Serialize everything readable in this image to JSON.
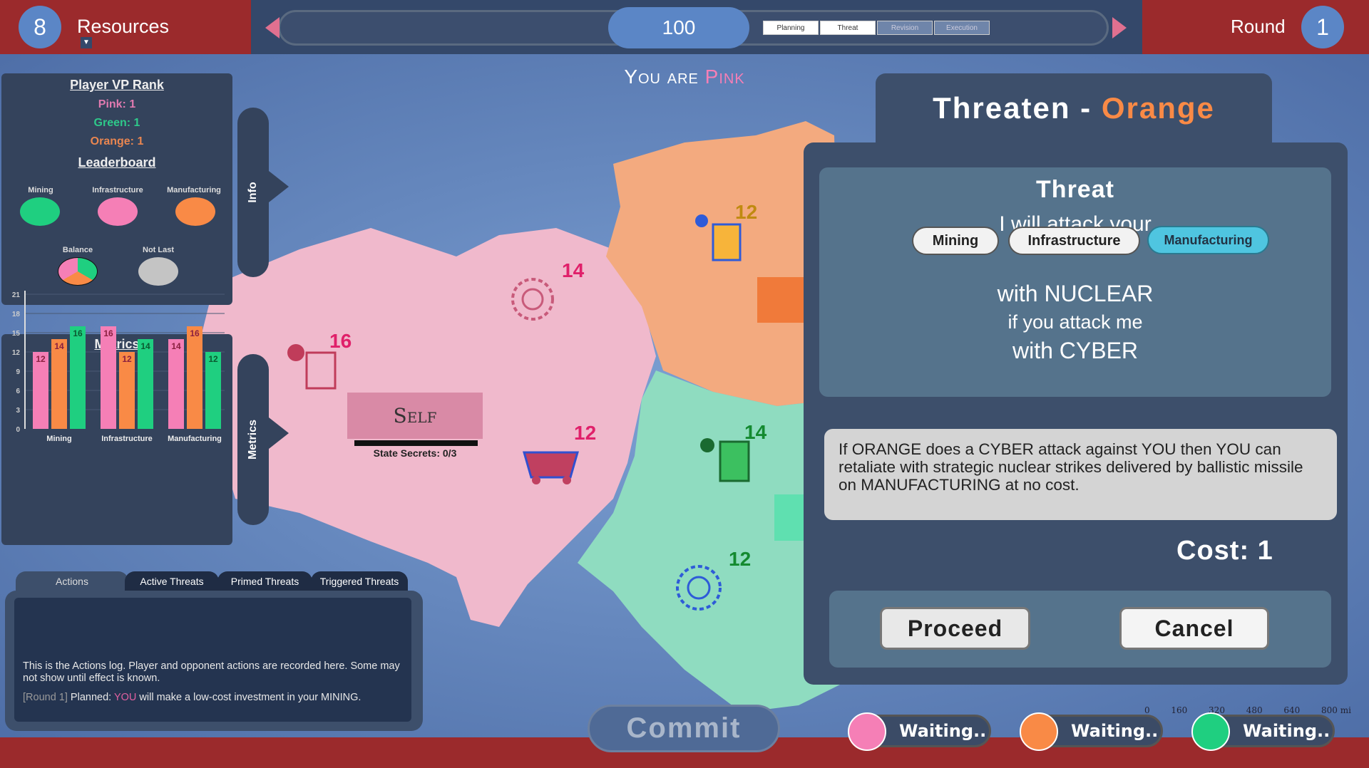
{
  "colors": {
    "pink": "#f57fb6",
    "green": "#1fcf80",
    "orange": "#f98a46",
    "grey": "#c4c4c4",
    "accent_blue": "#5b86c6",
    "header_red": "#9b2a2c"
  },
  "topbar": {
    "resources_count": "8",
    "resources_label": "Resources",
    "timer_value": "100",
    "phases": [
      "Planning",
      "Threat",
      "Revision",
      "Execution"
    ],
    "active_phases": [
      "Planning",
      "Threat"
    ],
    "round_label": "Round",
    "round_value": "1"
  },
  "banner": {
    "prefix": "You are",
    "player": "Pink"
  },
  "vp_rank": {
    "title": "Player VP Rank",
    "rows": [
      "Pink: 1",
      "Green: 1",
      "Orange: 1"
    ]
  },
  "leaderboard": {
    "title": "Leaderboard",
    "items": [
      {
        "label": "Mining",
        "color": "green"
      },
      {
        "label": "Infrastructure",
        "color": "pink"
      },
      {
        "label": "Manufacturing",
        "color": "orange"
      },
      {
        "label": "Balance",
        "color": "tri"
      },
      {
        "label": "Not Last",
        "color": "grey"
      }
    ]
  },
  "side_tabs": {
    "info": "Info",
    "metrics": "Metrics"
  },
  "chart_data": {
    "type": "bar",
    "title": "Metrics",
    "categories": [
      "Mining",
      "Infrastructure",
      "Manufacturing"
    ],
    "ylim": [
      0,
      21
    ],
    "yticks": [
      0,
      3,
      6,
      9,
      12,
      15,
      18,
      21
    ],
    "grid": true,
    "series": [
      {
        "color": "pink",
        "values": [
          12,
          16,
          14
        ]
      },
      {
        "color": "orange",
        "values": [
          14,
          12,
          16
        ]
      },
      {
        "color": "green",
        "values": [
          16,
          14,
          12
        ]
      }
    ]
  },
  "log": {
    "tabs": [
      "Actions",
      "Active Threats",
      "Primed Threats",
      "Triggered Threats"
    ],
    "active_tab": "Actions",
    "intro": "This is the Actions log. Player and opponent actions are recorded here. Some may not show until effect is known.",
    "entry_round": "[Round 1]",
    "entry_planned": "Planned:",
    "entry_you": "YOU",
    "entry_rest": "will make a low-cost investment in your MINING."
  },
  "map": {
    "self_label": "Self",
    "state_secrets": "State Secrets: 0/3",
    "values": {
      "pink_manufacturing": "16",
      "pink_infrastructure": "14",
      "pink_mining": "12",
      "orange_manufacturing": "12",
      "green_manufacturing": "14",
      "green_infrastructure": "12"
    },
    "scale": [
      "0",
      "160",
      "320",
      "480",
      "640",
      "800 mi"
    ]
  },
  "dialog": {
    "title": "Threaten -",
    "target": "Orange",
    "threat_heading": "Threat",
    "line1": "I will attack your",
    "targets": [
      "Mining",
      "Infrastructure",
      "Manufacturing"
    ],
    "selected_target": "Manufacturing",
    "line2": "with NUCLEAR",
    "line3": "if you attack me",
    "line4": "with CYBER",
    "description": "If ORANGE does a CYBER attack against YOU then YOU can retaliate with strategic nuclear strikes delivered by ballistic missile on MANUFACTURING at no cost.",
    "cost": "Cost: 1",
    "proceed": "Proceed",
    "cancel": "Cancel"
  },
  "commit_label": "Commit",
  "players_status": [
    {
      "color": "pink",
      "status": "Waiting.."
    },
    {
      "color": "orange",
      "status": "Waiting.."
    },
    {
      "color": "green",
      "status": "Waiting.."
    }
  ]
}
